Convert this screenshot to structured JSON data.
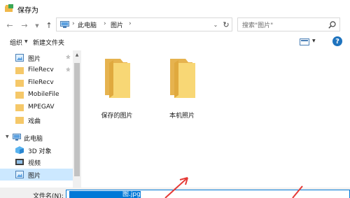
{
  "window": {
    "title": "保存为",
    "icon": "save-app-icon"
  },
  "navigation": {
    "back_icon": "back-arrow-icon",
    "forward_icon": "forward-arrow-icon",
    "recent_icon": "chevron-down-icon",
    "up_icon": "up-arrow-icon",
    "breadcrumb": [
      "此电脑",
      "图片"
    ],
    "refresh_icon": "refresh-icon"
  },
  "search": {
    "placeholder": "搜索\"图片\""
  },
  "toolbar": {
    "organize_label": "组织",
    "new_folder_label": "新建文件夹",
    "help_label": "?"
  },
  "sidebar": {
    "items": [
      {
        "label": "图片",
        "icon": "pictures-icon",
        "pinned": true
      },
      {
        "label": "FileRecv",
        "icon": "folder-icon",
        "pinned": true
      },
      {
        "label": "FileRecv",
        "icon": "folder-icon",
        "pinned": false
      },
      {
        "label": "MobileFile",
        "icon": "folder-icon",
        "pinned": false
      },
      {
        "label": "MPEGAV",
        "icon": "folder-icon",
        "pinned": false
      },
      {
        "label": "戏曲",
        "icon": "folder-icon",
        "pinned": false
      },
      {
        "label": "此电脑",
        "icon": "computer-icon",
        "pinned": false
      },
      {
        "label": "3D 对象",
        "icon": "3d-objects-icon",
        "pinned": false
      },
      {
        "label": "视频",
        "icon": "videos-icon",
        "pinned": false
      },
      {
        "label": "图片",
        "icon": "pictures-icon",
        "pinned": false,
        "selected": true
      }
    ]
  },
  "content": {
    "folders": [
      {
        "label": "保存的图片"
      },
      {
        "label": "本机照片"
      }
    ]
  },
  "footer": {
    "filename_label": "文件名(N):",
    "filename_value": "图.jpg"
  },
  "colors": {
    "accent": "#0078d7",
    "selection": "#cce8ff",
    "folder": "#f5c869",
    "annotation": "#e53935"
  }
}
